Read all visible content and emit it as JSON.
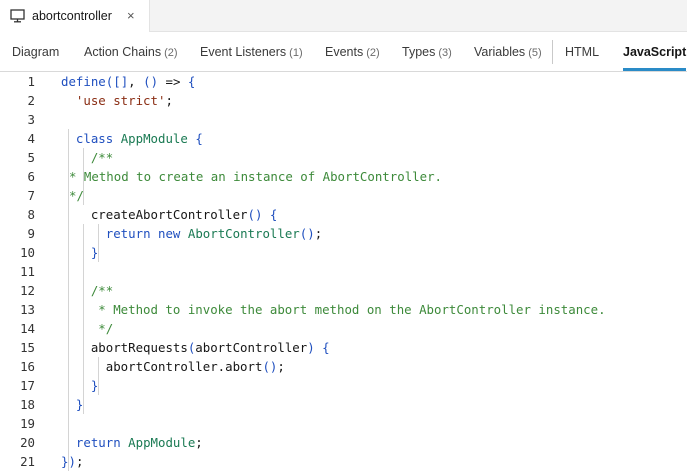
{
  "file_tab": {
    "name": "abortcontroller",
    "close": "×",
    "icon": "monitor-icon"
  },
  "designer_tabs": [
    {
      "label": "Diagram",
      "count": ""
    },
    {
      "label": "Action Chains",
      "count": "(2)"
    },
    {
      "label": "Event Listeners",
      "count": "(1)"
    },
    {
      "label": "Events",
      "count": "(2)"
    },
    {
      "label": "Types",
      "count": "(3)"
    },
    {
      "label": "Variables",
      "count": "(5)"
    },
    {
      "label": "HTML",
      "count": ""
    },
    {
      "label": "JavaScript",
      "count": ""
    }
  ],
  "active_tab": "JavaScript",
  "colors": {
    "accent": "#2a8bc7",
    "keyword_blue": "#1f4fbf",
    "type_green": "#1a7a53",
    "string": "#8a2d13",
    "comment": "#3d8a3a"
  },
  "code_lines": [
    {
      "n": "1",
      "text": "define([], () => {"
    },
    {
      "n": "2",
      "text": "  'use strict';"
    },
    {
      "n": "3",
      "text": ""
    },
    {
      "n": "4",
      "text": "  class AppModule {"
    },
    {
      "n": "5",
      "text": "    /**"
    },
    {
      "n": "6",
      "text": "* Method to create an instance of AbortController."
    },
    {
      "n": "7",
      "text": "*/"
    },
    {
      "n": "8",
      "text": "    createAbortController() {"
    },
    {
      "n": "9",
      "text": "      return new AbortController();"
    },
    {
      "n": "10",
      "text": "    }"
    },
    {
      "n": "11",
      "text": ""
    },
    {
      "n": "12",
      "text": "    /**"
    },
    {
      "n": "13",
      "text": "     * Method to invoke the abort method on the AbortController instance."
    },
    {
      "n": "14",
      "text": "     */"
    },
    {
      "n": "15",
      "text": "    abortRequests(abortController) {"
    },
    {
      "n": "16",
      "text": "      abortController.abort();"
    },
    {
      "n": "17",
      "text": "    }"
    },
    {
      "n": "18",
      "text": "  }"
    },
    {
      "n": "19",
      "text": ""
    },
    {
      "n": "20",
      "text": "  return AppModule;"
    },
    {
      "n": "21",
      "text": "});"
    }
  ]
}
